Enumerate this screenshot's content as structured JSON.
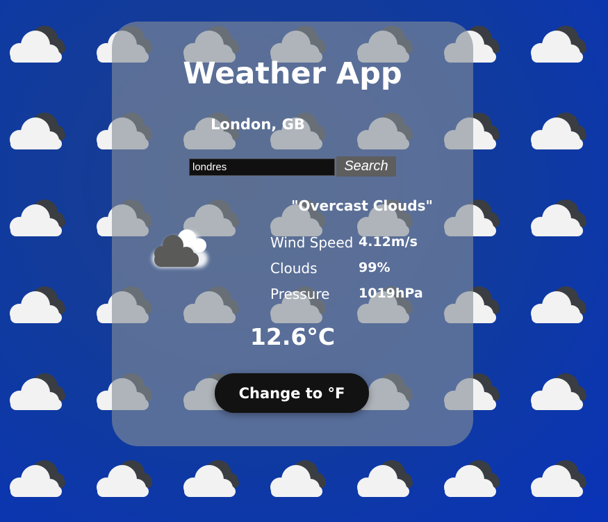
{
  "app": {
    "title": "Weather App"
  },
  "location": "London, GB",
  "search": {
    "value": "londres",
    "button_label": "Search"
  },
  "weather": {
    "description": "\"Overcast Clouds\"",
    "icon": "overcast-clouds-icon",
    "temperature": "12.6°C"
  },
  "stats": [
    {
      "label": "Wind Speed",
      "value": "4.12m/s"
    },
    {
      "label": "Clouds",
      "value": "99%"
    },
    {
      "label": "Pressure",
      "value": "1019hPa"
    }
  ],
  "unit_toggle": {
    "label": "Change to °F"
  },
  "colors": {
    "background": "#0f3aa0",
    "card": "#848e98",
    "button": "#121212",
    "search_button": "#5e5e5e"
  }
}
